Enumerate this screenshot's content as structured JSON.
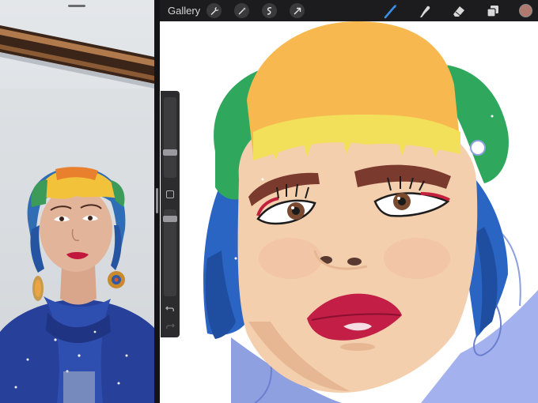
{
  "toolbar": {
    "gallery_label": "Gallery",
    "left_tools": [
      "wrench-icon",
      "magic-wand-icon",
      "selection-icon",
      "transform-arrow-icon"
    ],
    "right_tools": [
      "brush-icon",
      "smudge-icon",
      "eraser-icon",
      "layers-icon"
    ],
    "active_tool": "brush-icon",
    "current_color": "#b07a6e",
    "active_color": "#3a8ee6"
  },
  "sidebar": {
    "controls": [
      "brush-size-slider",
      "modify-button",
      "brush-opacity-slider",
      "undo-button",
      "redo-button"
    ]
  },
  "split_view": {
    "reference_pane": "reference-photo",
    "canvas": "painting-canvas"
  }
}
